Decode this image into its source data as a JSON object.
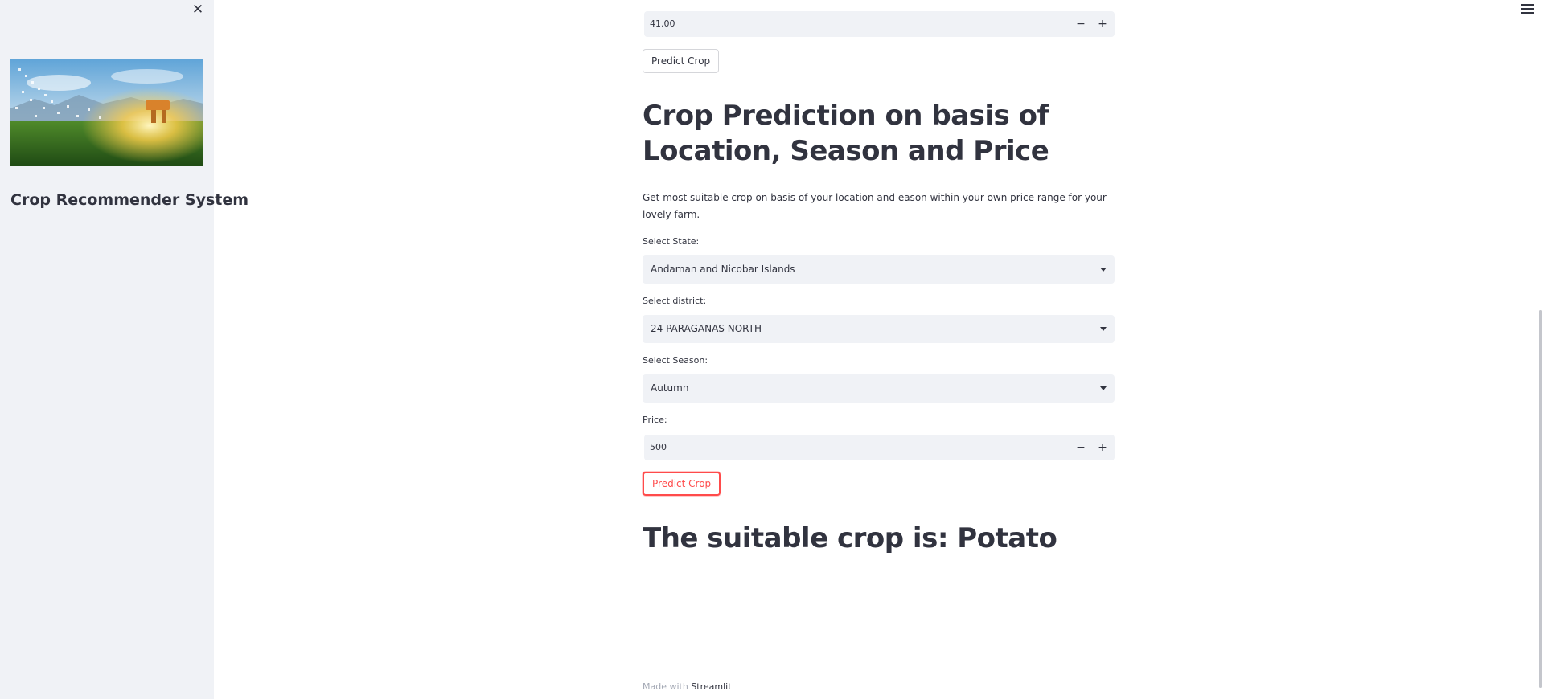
{
  "sidebar": {
    "title": "Crop Recommender System"
  },
  "form_top": {
    "number_value": "41.00",
    "predict_label": "Predict Crop"
  },
  "section": {
    "heading_line1": "Crop Prediction on basis of",
    "heading_line2": "Location, Season and Price",
    "description": "Get most suitable crop on basis of your location and eason within your own price range for your lovely farm.",
    "state_label": "Select State:",
    "state_value": "Andaman and Nicobar Islands",
    "district_label": "Select district:",
    "district_value": "24 PARAGANAS NORTH",
    "season_label": "Select Season:",
    "season_value": "Autumn",
    "price_label": "Price:",
    "price_value": "500",
    "predict_label": "Predict Crop",
    "result": "The suitable crop is: Potato"
  },
  "footer": {
    "made_with": "Made with",
    "brand": "Streamlit"
  },
  "icons": {
    "close": "close-icon",
    "menu": "hamburger-menu-icon",
    "minus": "minus-icon",
    "plus": "plus-icon",
    "dropdown": "chevron-down-icon"
  },
  "colors": {
    "primary": "#ff4b4b",
    "sidebar_bg": "#f0f2f6",
    "text": "#31333f"
  }
}
